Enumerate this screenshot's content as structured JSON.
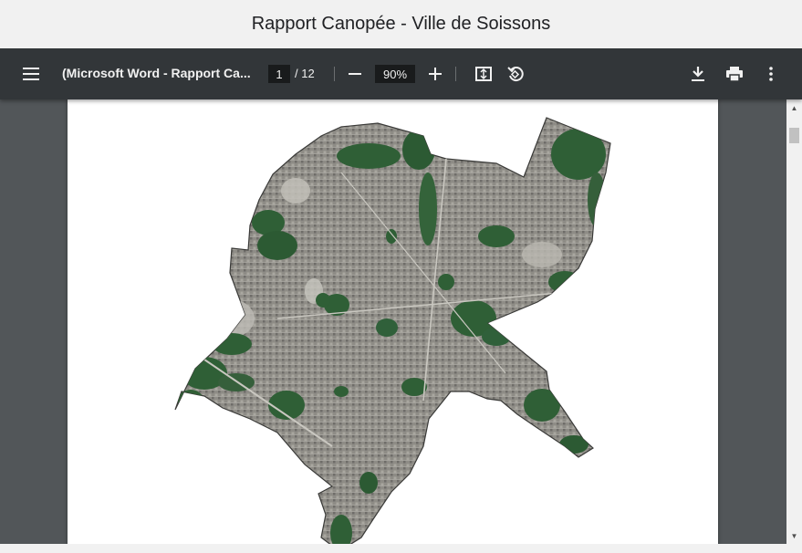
{
  "page": {
    "title": "Rapport Canopée - Ville de Soissons"
  },
  "toolbar": {
    "doc_title": "(Microsoft Word - Rapport Ca...",
    "current_page": "1",
    "page_separator": "/",
    "total_pages": "12",
    "zoom": "90%",
    "icons": {
      "menu": "menu-icon",
      "zoom_out": "minus-icon",
      "zoom_in": "plus-icon",
      "fit": "fit-page-icon",
      "rotate": "rotate-icon",
      "download": "download-icon",
      "print": "print-icon",
      "more": "more-vert-icon"
    }
  },
  "colors": {
    "toolbar_bg": "#323639",
    "viewer_bg": "#525659",
    "header_bg": "#f1f1f1",
    "canopy_green": "#2f5f36",
    "urban_gray": "#8d8b86"
  }
}
